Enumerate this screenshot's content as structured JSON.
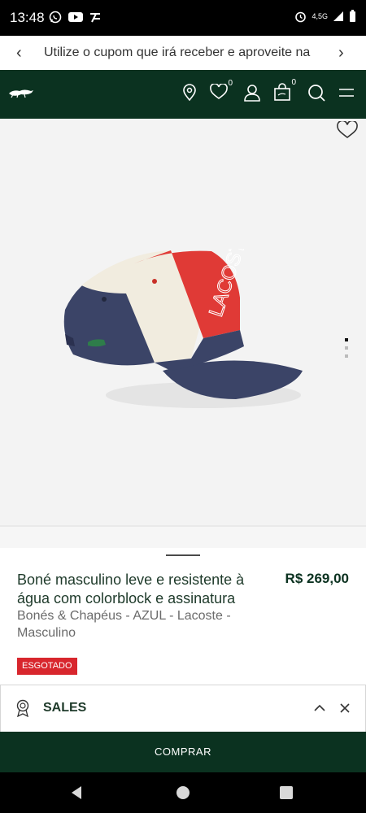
{
  "status_bar": {
    "time": "13:48",
    "network": "4,5G"
  },
  "promo": {
    "text": "Utilize o cupom que irá receber e aproveite na"
  },
  "header": {
    "wishlist_count": "0",
    "cart_count": "0"
  },
  "product": {
    "title": "Boné masculino leve e resistente à água com colorblock e assinatura",
    "price": "R$ 269,00",
    "meta": "Bonés & Chapéus - AZUL - Lacoste - Masculino",
    "badge": "ESGOTADO",
    "image_cap_text": "LACOSTE"
  },
  "carousel": {
    "total": 3,
    "active_index": 0
  },
  "sales": {
    "label": "SALES"
  },
  "buy": {
    "label": "COMPRAR"
  },
  "colors": {
    "brand_green": "#0b3220",
    "badge_red": "#d8262d",
    "cap_navy": "#3a4466",
    "cap_red": "#e03a36",
    "cap_cream": "#f1ecdf"
  }
}
